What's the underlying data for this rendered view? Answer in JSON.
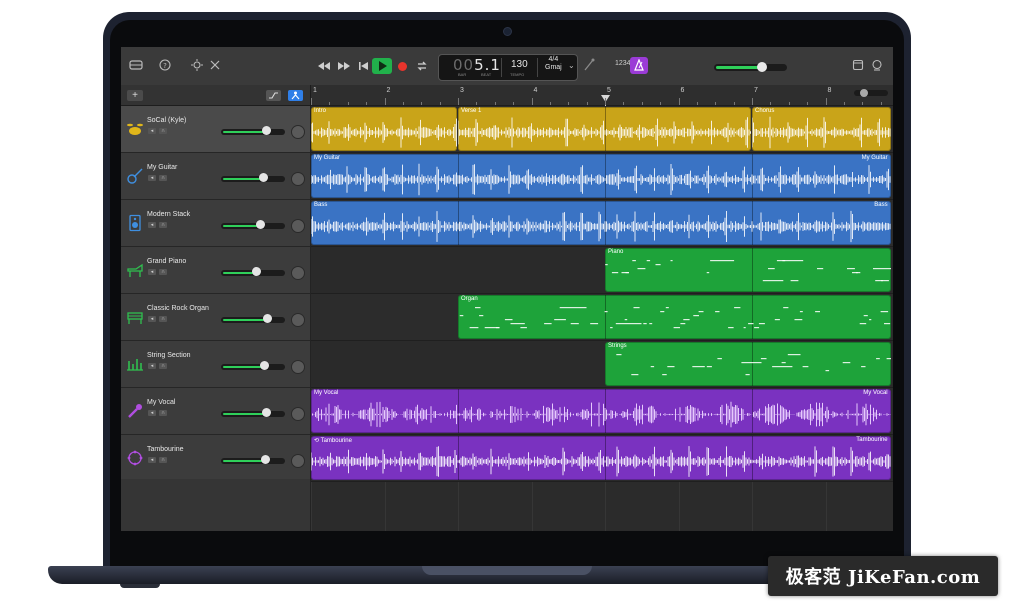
{
  "colors": {
    "yellow_region": "#c9a419",
    "blue_region": "#3a73c4",
    "green_region": "#1ea33a",
    "purple_region": "#7a32c0",
    "meter_green": "#2fd05a",
    "play_green": "#21b14b",
    "record_red": "#e8342c",
    "smart_controls_purple": "#9a3bd6"
  },
  "toolbar": {
    "left_icons": [
      "library-icon",
      "help-icon",
      "smart-controls-icon",
      "editors-icon"
    ],
    "transport_icons": [
      "rewind-icon",
      "fast-forward-icon",
      "go-to-beginning-icon",
      "play-icon",
      "record-icon",
      "cycle-icon"
    ],
    "lcd": {
      "position_dim": "00",
      "position": "5.1",
      "bar_label": "BAR",
      "beat_label": "BEAT",
      "tempo": "130",
      "tempo_label": "TEMPO",
      "time_signature": "4/4",
      "key": "Gmaj"
    },
    "count_in": "1234",
    "right_icons": [
      "note-pad-icon",
      "loop-browser-icon"
    ]
  },
  "tracks": [
    {
      "name": "SoCal (Kyle)",
      "icon": "drum-kit-icon",
      "icon_color": "#e0b61a",
      "volume": 0.72,
      "selected": true
    },
    {
      "name": "My Guitar",
      "icon": "guitar-icon",
      "icon_color": "#3f8fe0",
      "volume": 0.66,
      "selected": false
    },
    {
      "name": "Modern Stack",
      "icon": "amp-icon",
      "icon_color": "#3f8fe0",
      "volume": 0.62,
      "selected": false
    },
    {
      "name": "Grand Piano",
      "icon": "piano-icon",
      "icon_color": "#2fbf4f",
      "volume": 0.55,
      "selected": false
    },
    {
      "name": "Classic Rock Organ",
      "icon": "organ-icon",
      "icon_color": "#2fbf4f",
      "volume": 0.74,
      "selected": false
    },
    {
      "name": "String Section",
      "icon": "strings-icon",
      "icon_color": "#2fbf4f",
      "volume": 0.68,
      "selected": false
    },
    {
      "name": "My Vocal",
      "icon": "microphone-icon",
      "icon_color": "#b04ee0",
      "volume": 0.72,
      "selected": false
    },
    {
      "name": "Tambourine",
      "icon": "tambourine-icon",
      "icon_color": "#b04ee0",
      "volume": 0.7,
      "selected": false
    }
  ],
  "ruler": {
    "bars": [
      "1",
      "2",
      "3",
      "4",
      "5",
      "6",
      "7",
      "8"
    ]
  },
  "playhead_bar": 5,
  "regions": [
    {
      "lane": 0,
      "name": "Intro",
      "start": 1.0,
      "end": 3.0,
      "color": "#c9a419",
      "kind": "audio"
    },
    {
      "lane": 0,
      "name": "Verse 1",
      "start": 3.0,
      "end": 7.0,
      "color": "#c9a419",
      "kind": "audio"
    },
    {
      "lane": 0,
      "name": "Chorus",
      "start": 7.0,
      "end": 8.9,
      "color": "#c9a419",
      "kind": "audio"
    },
    {
      "lane": 1,
      "name": "My Guitar",
      "name_right": "My Guitar",
      "start": 1.0,
      "end": 8.9,
      "color": "#3a73c4",
      "kind": "audio"
    },
    {
      "lane": 2,
      "name": "Bass",
      "name_right": "Bass",
      "start": 1.0,
      "end": 8.9,
      "color": "#3a73c4",
      "kind": "audio"
    },
    {
      "lane": 3,
      "name": "Piano",
      "start": 5.0,
      "end": 8.9,
      "color": "#1ea33a",
      "kind": "midi"
    },
    {
      "lane": 4,
      "name": "Organ",
      "start": 3.0,
      "end": 8.9,
      "color": "#1ea33a",
      "kind": "midi"
    },
    {
      "lane": 5,
      "name": "Strings",
      "start": 5.0,
      "end": 8.9,
      "color": "#1ea33a",
      "kind": "midi"
    },
    {
      "lane": 6,
      "name": "My Vocal",
      "name_right": "My Vocal",
      "start": 1.0,
      "end": 8.9,
      "color": "#7a32c0",
      "kind": "vocal"
    },
    {
      "lane": 7,
      "name": "Tambourine",
      "name_right": "Tambourine",
      "start": 1.0,
      "end": 8.9,
      "color": "#7a32c0",
      "kind": "audio"
    }
  ],
  "watermark": "极客范 JiKeFan.com"
}
